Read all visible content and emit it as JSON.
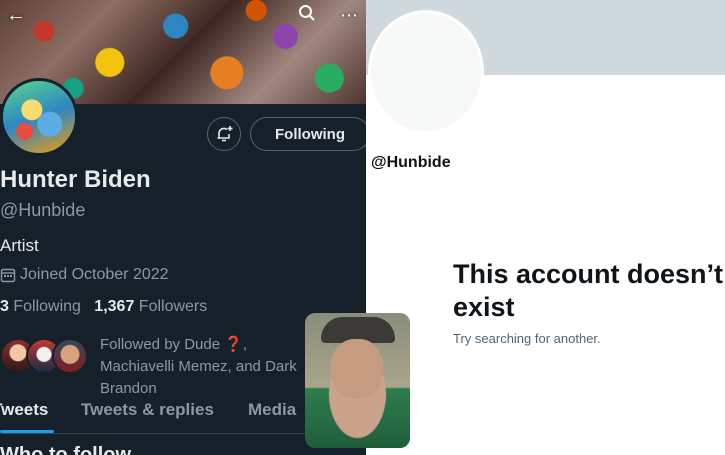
{
  "left_profile": {
    "header_icons": {
      "back": "back-arrow-icon",
      "search": "search-icon",
      "more": "more-icon"
    },
    "buttons": {
      "notify_icon": "bell-plus-icon",
      "following": "Following"
    },
    "name": "Hunter Biden",
    "handle": "@Hunbide",
    "bio": "Artist",
    "joined": "Joined October 2022",
    "following_count": "3",
    "following_label": "Following",
    "followers_count": "1,367",
    "followers_label": "Followers",
    "followed_by": "Followed by Dude ❓, Machiavelli Memez, and Dark Brandon",
    "tabs": [
      {
        "label": "Tweets",
        "active": true
      },
      {
        "label": "Tweets & replies",
        "active": false
      },
      {
        "label": "Media",
        "active": false
      }
    ],
    "section_heading": "Who to follow"
  },
  "right_profile": {
    "handle": "@Hunbide",
    "title": "This account doesn’t exist",
    "subtitle": "Try searching for another."
  },
  "colors": {
    "dark_bg": "#15202b",
    "accent": "#1d9bf0",
    "light_bg": "#ffffff",
    "banner_placeholder": "#cfd9de"
  }
}
